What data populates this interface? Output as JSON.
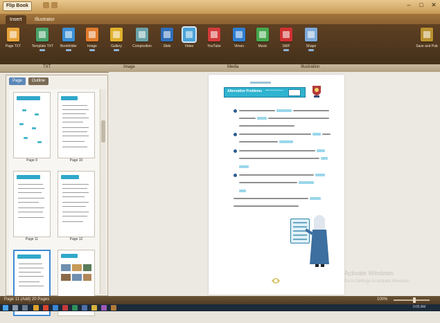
{
  "window": {
    "title": "Flip Book",
    "controls": [
      "–",
      "□",
      "✕"
    ]
  },
  "ribbon_tabs": [
    "Insert",
    "Illustrator"
  ],
  "ribbon_buttons": [
    {
      "label": "Page TXT",
      "color": "#e8a33a",
      "icon": "page-text-icon"
    },
    {
      "label": "Template TXT",
      "color": "#4aa36b",
      "icon": "template-icon"
    },
    {
      "label": "Bookfolder",
      "color": "#3b8fd4",
      "icon": "folder-icon"
    },
    {
      "label": "Image",
      "color": "#e07b2d",
      "icon": "image-icon"
    },
    {
      "label": "Gallery",
      "color": "#e0b12d",
      "icon": "gallery-icon"
    },
    {
      "label": "Composition",
      "color": "#6aa2a8",
      "icon": "composition-icon"
    },
    {
      "label": "Slide",
      "color": "#2f6fb8",
      "icon": "slide-icon"
    },
    {
      "label": "Video",
      "color": "#4aa3d8",
      "icon": "video-icon"
    },
    {
      "label": "YouTube",
      "color": "#d43b3b",
      "icon": "youtube-icon"
    },
    {
      "label": "Vimeo",
      "color": "#2f7fd0",
      "icon": "vimeo-icon"
    },
    {
      "label": "Music",
      "color": "#46a84e",
      "icon": "music-icon"
    },
    {
      "label": "SWF",
      "color": "#cf3131",
      "icon": "swf-icon"
    },
    {
      "label": "Shape",
      "color": "#7da9d9",
      "icon": "shape-icon"
    },
    {
      "label": "Save and Pub",
      "color": "#b9912f",
      "icon": "save-publish-icon"
    }
  ],
  "group_labels": [
    "TXT",
    "Image",
    "Media",
    "Illustration"
  ],
  "left_panel": {
    "tabs": [
      "Page",
      "Outline"
    ],
    "thumbnails": [
      {
        "caption": "Page 9"
      },
      {
        "caption": "Page 10"
      },
      {
        "caption": "Page 11"
      },
      {
        "caption": "Page 12"
      },
      {
        "caption": ""
      },
      {
        "caption": ""
      }
    ]
  },
  "page_content": {
    "banner_title": "Alternative Problems"
  },
  "watermark": {
    "line1": "Activate Windows",
    "line2": "Go to Settings to activate Windows."
  },
  "status": {
    "page_info": "Page 11 (Add) 20 Pages",
    "zoom": "100%"
  },
  "taskbar": {
    "clock": "0:05 AM"
  }
}
